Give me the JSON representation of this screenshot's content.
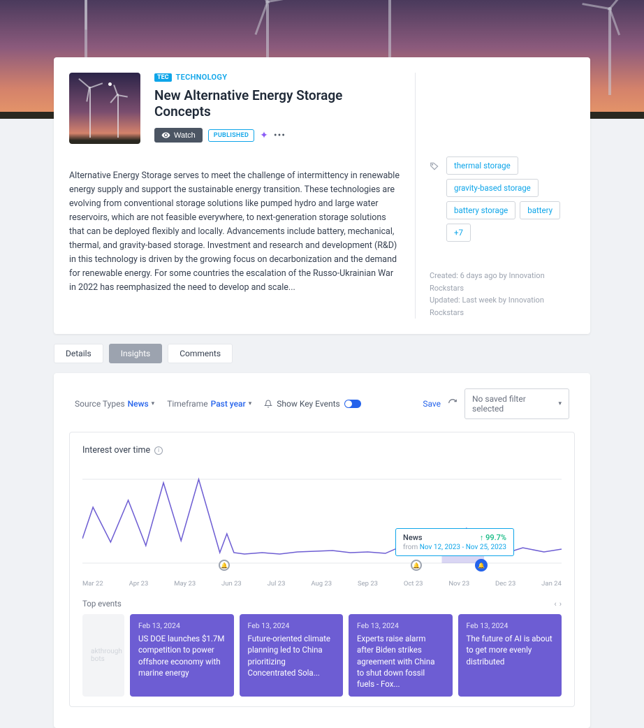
{
  "header": {
    "category_badge": "TEC",
    "category_text": "TECHNOLOGY",
    "title": "New Alternative Energy Storage Concepts",
    "watch_label": "Watch",
    "status_badge": "PUBLISHED",
    "description": "Alternative Energy Storage serves to meet the challenge of intermittency in renewable energy supply and support the sustainable energy transition. These technologies are evolving from conventional storage solutions like pumped hydro and large water reservoirs, which are not feasible everywhere, to next-generation storage solutions that can be deployed flexibly and locally. Advancements include battery, mechanical, thermal, and gravity-based storage. Investment and research and development (R&D) in this technology is driven by the growing focus on decarbonization and the demand for renewable energy. For some countries the escalation of the Russo-Ukrainian War in 2022 has reemphasized the need to develop and scale..."
  },
  "sidebar": {
    "tags": [
      "thermal storage",
      "gravity-based storage",
      "battery storage",
      "battery",
      "+7"
    ],
    "created": "Created: 6 days ago by Innovation Rockstars",
    "updated": "Updated: Last week by Innovation Rockstars"
  },
  "tabs": {
    "details": "Details",
    "insights": "Insights",
    "comments": "Comments"
  },
  "filters": {
    "source_label": "Source Types",
    "source_value": "News",
    "timeframe_label": "Timeframe",
    "timeframe_value": "Past year",
    "key_events_label": "Show Key Events",
    "save_label": "Save",
    "filter_placeholder": "No saved filter selected"
  },
  "chart": {
    "title": "Interest over time",
    "tooltip_label": "News",
    "tooltip_value": "↑ 99.7%",
    "tooltip_from": "from",
    "tooltip_range": "Nov 12, 2023 - Nov 25, 2023",
    "axis": [
      "Mar 22",
      "Apr 23",
      "May 23",
      "Jun 23",
      "Jul 23",
      "Aug 23",
      "Sep 23",
      "Oct 23",
      "Nov 23",
      "Dec 23",
      "Jan 24"
    ]
  },
  "chart_data": {
    "type": "line",
    "title": "Interest over time",
    "x": [
      "Mar 22",
      "Apr 23",
      "May 23",
      "Jun 23",
      "Jul 23",
      "Aug 23",
      "Sep 23",
      "Oct 23",
      "Nov 23",
      "Dec 23",
      "Jan 24"
    ],
    "series": [
      {
        "name": "News",
        "color": "#6d5dd3",
        "values_normalized": [
          35,
          70,
          25,
          75,
          20,
          90,
          25,
          95,
          15,
          30,
          18,
          16,
          18,
          17,
          19,
          20,
          22,
          18,
          19,
          16,
          25,
          20,
          38,
          25,
          18,
          26,
          20
        ]
      }
    ],
    "ylim": [
      0,
      100
    ],
    "key_event_markers": [
      "Jun 23",
      "Oct 23",
      "Nov 23"
    ],
    "tooltip": {
      "label": "News",
      "change_pct": 99.7,
      "direction": "up",
      "range": "Nov 12, 2023 - Nov 25, 2023"
    }
  },
  "top_events": {
    "label": "Top events",
    "ghost": "akthrough bots",
    "items": [
      {
        "date": "Feb 13, 2024",
        "title": "US DOE launches $1.7M competition to power offshore economy with marine energy"
      },
      {
        "date": "Feb 13, 2024",
        "title": "Future-oriented climate planning led to China prioritizing Concentrated Sola..."
      },
      {
        "date": "Feb 13, 2024",
        "title": "Experts raise alarm after Biden strikes agreement with China to shut down fossil fuels - Fox..."
      },
      {
        "date": "Feb 13, 2024",
        "title": "The future of AI is about to get more evenly distributed"
      }
    ]
  }
}
